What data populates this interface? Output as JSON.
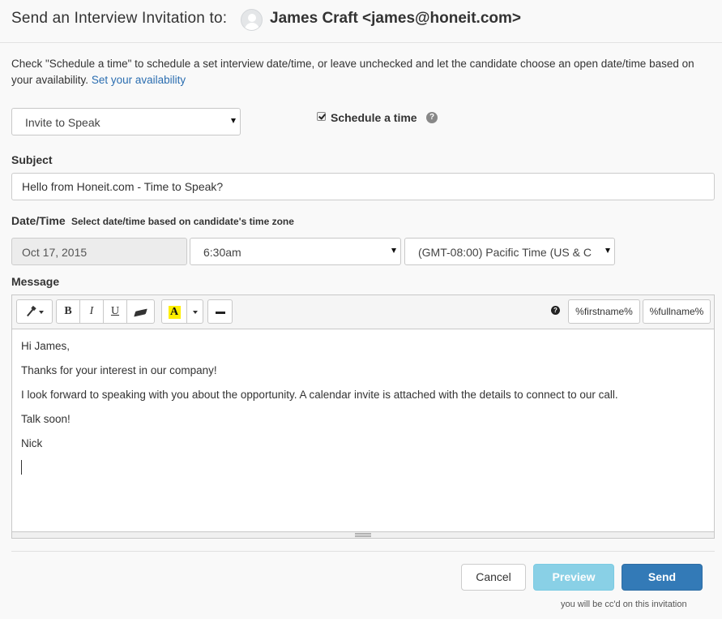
{
  "header": {
    "title": "Send an Interview Invitation to:",
    "recipient": "James Craft <james@honeit.com>",
    "avatar_icon": "user-avatar-icon"
  },
  "intro": {
    "text": "Check \"Schedule a time\" to schedule a set interview date/time, or leave unchecked and let the candidate choose an open date/time based on your availability.",
    "link": "Set your availability"
  },
  "invite_type": {
    "selected": "Invite to Speak"
  },
  "schedule": {
    "label": "Schedule a time",
    "checked": true,
    "help_icon": "question-circle-icon"
  },
  "subject": {
    "label": "Subject",
    "value": "Hello from Honeit.com - Time to Speak?"
  },
  "datetime": {
    "label": "Date/Time",
    "hint": "Select date/time based on candidate's time zone",
    "date": "Oct 17, 2015",
    "time": "6:30am",
    "timezone": "(GMT-08:00) Pacific Time (US & C"
  },
  "message": {
    "label": "Message",
    "toolbar": {
      "bold": "B",
      "italic": "I",
      "underline": "U",
      "color": "A",
      "help": "?",
      "var_firstname": "%firstname%",
      "var_fullname": "%fullname%"
    },
    "lines": [
      "Hi James,",
      "Thanks for your interest in our company!",
      "I look forward to speaking with you about the opportunity. A calendar invite is attached with the details to connect to our call.",
      "Talk soon!",
      "Nick"
    ]
  },
  "actions": {
    "cancel": "Cancel",
    "preview": "Preview",
    "send": "Send",
    "cc_note": "you will be cc'd on this invitation"
  }
}
